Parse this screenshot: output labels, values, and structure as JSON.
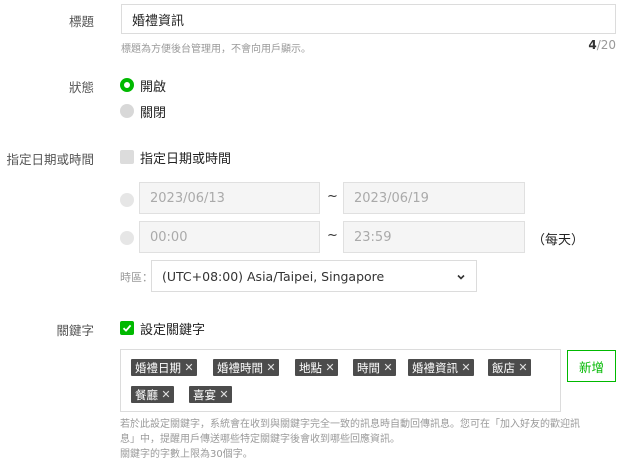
{
  "title_row": {
    "label": "標題",
    "value": "婚禮資訊",
    "hint": "標題為方便後台管理用，不會向用戶顯示。",
    "count_current": "4",
    "count_max": "/20"
  },
  "status_row": {
    "label": "狀態",
    "options": [
      "開啟",
      "關閉"
    ],
    "selected": "開啟"
  },
  "datetime_row": {
    "label": "指定日期或時間",
    "checkbox_label": "指定日期或時間",
    "date_start": "2023/06/13",
    "date_end": "2023/06/19",
    "time_start": "00:00",
    "time_end": "23:59",
    "tilde": "~",
    "daily_label": "（每天）",
    "timezone_label": "時區：",
    "timezone_value": "(UTC+08:00) Asia/Taipei, Singapore"
  },
  "keyword_row": {
    "label": "關鍵字",
    "checkbox_label": "設定關鍵字",
    "tags": [
      "婚禮日期",
      "婚禮時間",
      "地點",
      "時間",
      "婚禮資訊",
      "飯店",
      "餐廳",
      "喜宴"
    ],
    "add_label": "新增",
    "note_lines": [
      "若於此設定關鍵字，系統會在收到與關鍵字完全一致的訊息時自動回傳訊息。您可在「加入好友的歡迎訊",
      "息」中，提醒用戶傳送哪些特定關鍵字後會收到哪些回應資訊。",
      "關鍵字的字數上限為30個字。"
    ]
  },
  "colors": {
    "accent": "#00b900",
    "tag_bg": "#4c4c4c",
    "border": "#dcdcdc"
  }
}
